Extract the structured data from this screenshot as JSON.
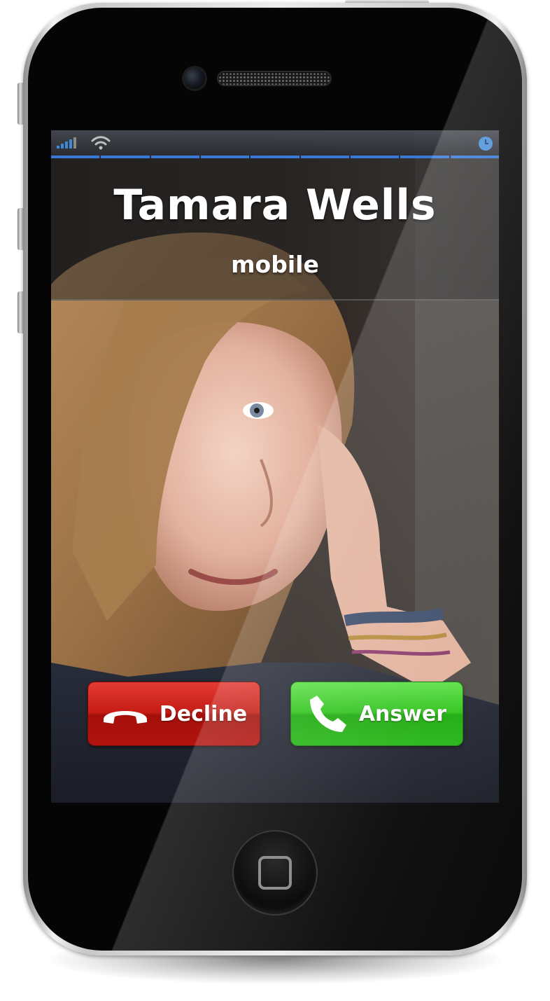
{
  "caller": {
    "name": "Tamara Wells",
    "label": "mobile"
  },
  "actions": {
    "decline_label": "Decline",
    "answer_label": "Answer"
  },
  "status_bar": {
    "signal_icon": "signal-bars-icon",
    "wifi_icon": "wifi-icon",
    "clock_icon": "clock-icon",
    "accent_color": "#3a78d8"
  },
  "colors": {
    "decline": "#c51d16",
    "answer": "#2fc31c"
  },
  "background_image": "caller-photo"
}
